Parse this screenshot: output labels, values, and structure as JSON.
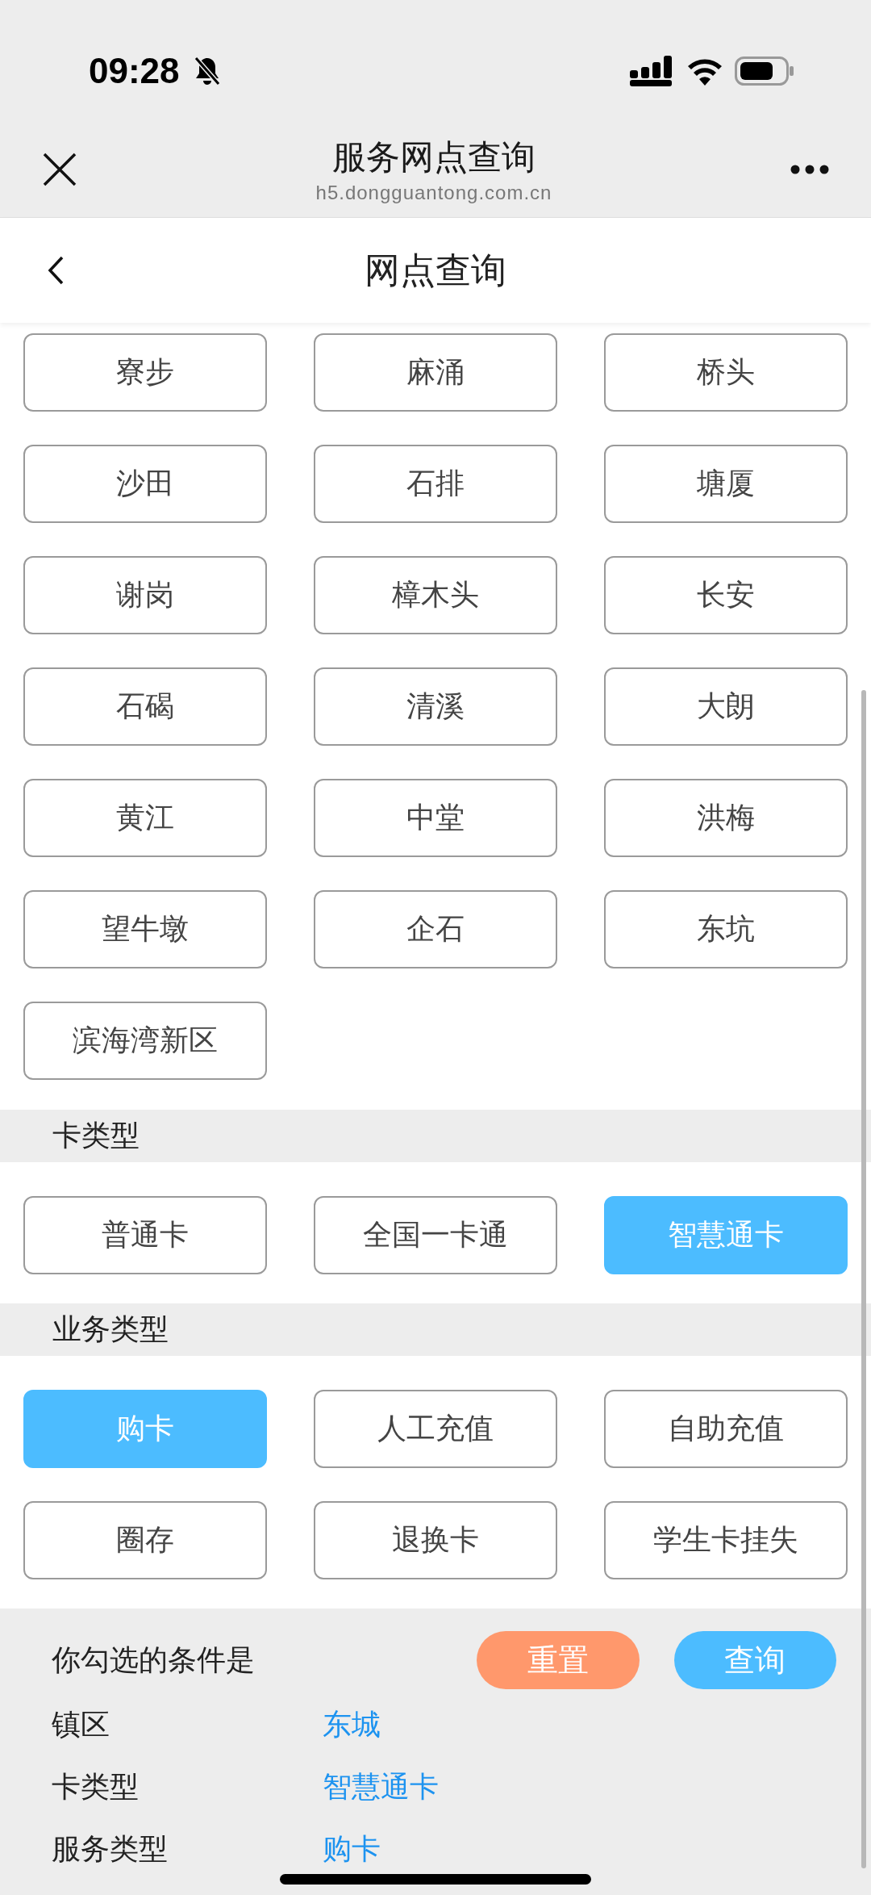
{
  "status_bar": {
    "time": "09:28"
  },
  "browser": {
    "title": "服务网点查询",
    "url": "h5.dongguantong.com.cn"
  },
  "page": {
    "title": "网点查询"
  },
  "sections": [
    {
      "options": [
        {
          "label": "寮步",
          "selected": false
        },
        {
          "label": "麻涌",
          "selected": false
        },
        {
          "label": "桥头",
          "selected": false
        },
        {
          "label": "沙田",
          "selected": false
        },
        {
          "label": "石排",
          "selected": false
        },
        {
          "label": "塘厦",
          "selected": false
        },
        {
          "label": "谢岗",
          "selected": false
        },
        {
          "label": "樟木头",
          "selected": false
        },
        {
          "label": "长安",
          "selected": false
        },
        {
          "label": "石碣",
          "selected": false
        },
        {
          "label": "清溪",
          "selected": false
        },
        {
          "label": "大朗",
          "selected": false
        },
        {
          "label": "黄江",
          "selected": false
        },
        {
          "label": "中堂",
          "selected": false
        },
        {
          "label": "洪梅",
          "selected": false
        },
        {
          "label": "望牛墩",
          "selected": false
        },
        {
          "label": "企石",
          "selected": false
        },
        {
          "label": "东坑",
          "selected": false
        },
        {
          "label": "滨海湾新区",
          "selected": false
        }
      ]
    },
    {
      "heading": "卡类型",
      "options": [
        {
          "label": "普通卡",
          "selected": false
        },
        {
          "label": "全国一卡通",
          "selected": false
        },
        {
          "label": "智慧通卡",
          "selected": true
        }
      ]
    },
    {
      "heading": "业务类型",
      "options": [
        {
          "label": "购卡",
          "selected": true
        },
        {
          "label": "人工充值",
          "selected": false
        },
        {
          "label": "自助充值",
          "selected": false
        },
        {
          "label": "圈存",
          "selected": false
        },
        {
          "label": "退换卡",
          "selected": false
        },
        {
          "label": "学生卡挂失",
          "selected": false
        }
      ]
    }
  ],
  "summary": {
    "heading": "你勾选的条件是",
    "buttons": [
      {
        "label": "重置",
        "kind": "reset"
      },
      {
        "label": "查询",
        "kind": "query"
      }
    ],
    "rows": [
      {
        "label": "镇区",
        "value": "东城"
      },
      {
        "label": "卡类型",
        "value": "智慧通卡"
      },
      {
        "label": "服务类型",
        "value": "购卡"
      }
    ]
  }
}
